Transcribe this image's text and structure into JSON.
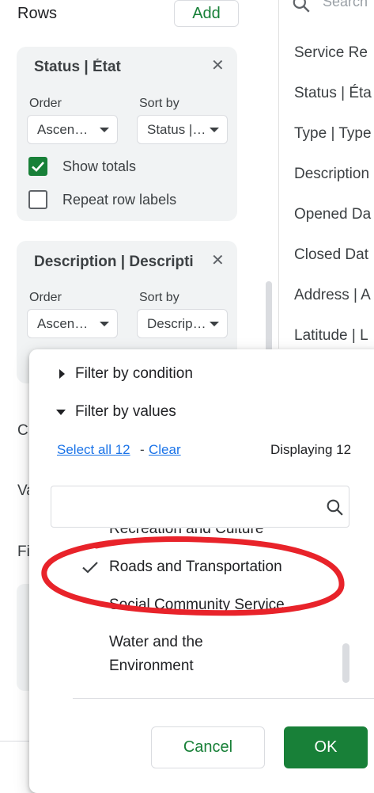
{
  "rows_section": {
    "title": "Rows",
    "add_label": "Add"
  },
  "cards": [
    {
      "title": "Status | État",
      "order_label": "Order",
      "order_value": "Ascen…",
      "sortby_label": "Sort by",
      "sortby_value": "Status |…",
      "show_totals_label": "Show totals",
      "show_totals_checked": true,
      "repeat_label": "Repeat row labels",
      "repeat_checked": false
    },
    {
      "title": "Description | Descripti",
      "order_label": "Order",
      "order_value": "Ascen…",
      "sortby_label": "Sort by",
      "sortby_value": "Descrip…"
    }
  ],
  "side_peek": [
    "C",
    "Va",
    "Fi"
  ],
  "columns_panel": {
    "search_placeholder": "Search",
    "items": [
      "Service Re",
      "Status | Éta",
      "Type | Type",
      "Description",
      "Opened Da",
      "Closed Dat",
      "Address | A",
      "Latitude | L"
    ]
  },
  "filter_popup": {
    "filter_by_condition": "Filter by condition",
    "filter_by_values": "Filter by values",
    "select_all": "Select all 12",
    "separator": "-",
    "clear": "Clear",
    "displaying": "Displaying 12",
    "search_value": "",
    "values": [
      {
        "label": "Recreation and Culture",
        "checked": false
      },
      {
        "label": "Roads and Transportation",
        "checked": true
      },
      {
        "label": "Social Community Service",
        "checked": false
      },
      {
        "label": "Water and the",
        "checked": false
      },
      {
        "label": "Environment",
        "checked": false
      }
    ],
    "cancel_label": "Cancel",
    "ok_label": "OK"
  },
  "colors": {
    "accent_green": "#188038",
    "link_blue": "#1a73e8",
    "annotation_red": "#e8232a"
  }
}
